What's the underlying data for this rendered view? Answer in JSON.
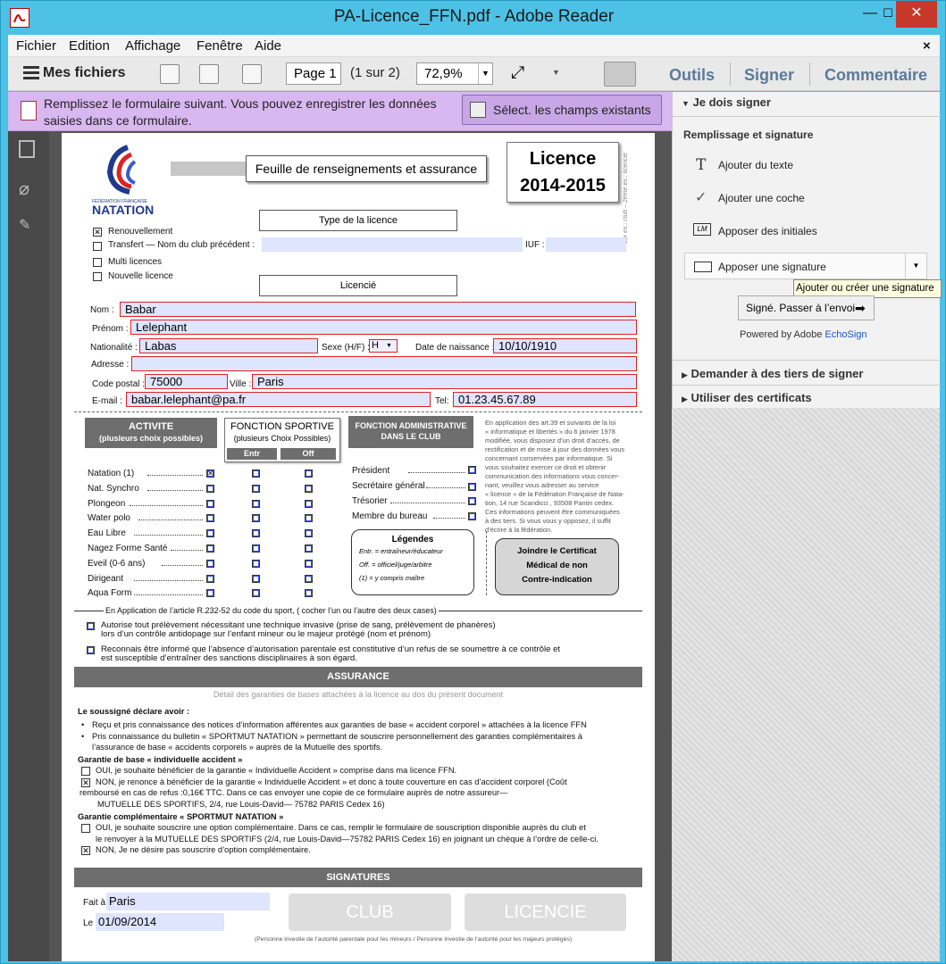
{
  "window": {
    "title": "PA-Licence_FFN.pdf - Adobe Reader",
    "minimize": "—",
    "maximize": "☐",
    "close": "✕"
  },
  "menu": {
    "items": [
      "Fichier",
      "Edition",
      "Affichage",
      "Fenêtre",
      "Aide"
    ],
    "close": "×"
  },
  "toolbar": {
    "my_files": "Mes fichiers",
    "page_value": "Page 1",
    "page_of": "(1 sur 2)",
    "zoom": "72,9%",
    "tabs": [
      "Outils",
      "Signer",
      "Commentaire"
    ]
  },
  "notice": {
    "text": "Remplissez le formulaire suivant. Vous pouvez enregistrer les données saisies dans ce formulaire.",
    "button": "Sélect. les champs existants"
  },
  "panel": {
    "section1": "Je dois signer",
    "subheading": "Remplissage et signature",
    "items": [
      "Ajouter du texte",
      "Ajouter une coche",
      "Apposer des initiales",
      "Apposer une signature"
    ],
    "tooltip": "Ajouter ou créer une signature",
    "send_button": "Signé. Passer à l’envoi",
    "powered": "Powered by Adobe",
    "powered_link": "EchoSign",
    "section2": "Demander à des tiers de signer",
    "section3": "Utiliser des certificats"
  },
  "form": {
    "header_title": "Feuille de renseignements et assurance",
    "licence_l1": "Licence",
    "licence_l2": "2014-2015",
    "logo_small": "FÉDÉRATION FRANÇAISE",
    "logo_big": "NATATION",
    "vertical_note": "1er ex.: club – 2ème ex.: licencié",
    "type_title": "Type de la licence",
    "type_items": [
      "Renouvellement",
      "Transfert — Nom du club précédent :",
      "Multi licences",
      "Nouvelle licence"
    ],
    "iuf": "IUF :",
    "licencie_title": "Licencié",
    "labels": {
      "nom": "Nom :",
      "prenom": "Prénom :",
      "nationalite": "Nationalité :",
      "sexe": "Sexe (H/F) :",
      "naissance": "Date de naissance :",
      "adresse": "Adresse :",
      "cp": "Code postal :",
      "ville": "Ville :",
      "email": "E-mail :",
      "tel": "Tel:"
    },
    "values": {
      "nom": "Babar",
      "prenom": "Lelephant",
      "nationalite": "Labas",
      "sexe": "H",
      "naissance": "10/10/1910",
      "adresse": "",
      "cp": "75000",
      "ville": "Paris",
      "email": "babar.lelephant@pa.fr",
      "tel": "01.23.45.67.89"
    },
    "activite_title": "ACTIVITE",
    "activite_sub": "(plusieurs choix possibles)",
    "sportive_title": "FONCTION SPORTIVE",
    "sportive_sub": "(plusieurs Choix Possibles)",
    "col_entr": "Entr",
    "col_off": "Off",
    "admin_title": "FONCTION ADMINISTRATIVE",
    "admin_sub": "DANS LE CLUB",
    "activities": [
      "Natation (1)",
      "Nat. Synchro",
      "Plongeon",
      "Water polo",
      "Eau Libre",
      "Nagez Forme Santé",
      "Eveil (0-6 ans)",
      "Dirigeant",
      "Aqua Form"
    ],
    "admin_items": [
      "Président",
      "Secrétaire général",
      "Trésorier",
      "Membre du bureau"
    ],
    "privacy": [
      "En application des art.39 et suivants de la loi",
      "« informatique et libertés » du 6 janvier 1978",
      "modifiée, vous disposez d’un droit d’accès, de",
      "rectification et de mise à jour des données vous",
      "concernant conservées par informatique. Si",
      "vous souhaitez exercer ce droit et obtenir",
      "communication des informations vous concer-",
      "nant, veuillez vous adresser au service",
      "« licence » de la Fédération Française de Nata-",
      "tion, 14 rue Scandicci , 93508 Pantin cedex.",
      "Ces informations peuvent être communiquées",
      "à des tiers. Si vous vous y opposez, il suffit",
      "d’écrire à la fédération."
    ],
    "legend_title": "Légendes",
    "legend_items": [
      "Entr. = entraîneur/éducateur",
      "Off.  = officiel/juge/arbitre",
      "(1) = y compris maître"
    ],
    "cert_lines": [
      "Joindre le Certificat",
      "Médical de non",
      "Contre-indication"
    ],
    "art_line": "En Application de l’article R.232-52 du code du sport,  ( cocher l’un ou l’autre des deux cases)",
    "auth1": "Autorise tout prélèvement nécessitant une technique invasive (prise de sang, prélèvement de phanères)",
    "auth1b": "lors d’un contrôle antidopage sur l’enfant mineur ou le majeur protégé (nom et prénom)",
    "auth2": "Reconnais être informé que l’absence d’autorisation parentale est constitutive d’un refus de se soumettre à ce contrôle et",
    "auth2b": "est susceptible d’entraîner des sanctions disciplinaires à son égard.",
    "assurance_title": "ASSURANCE",
    "assurance_sub": "Détail des garanties de bases attachées à la licence au dos du présent document",
    "declare": "Le soussigné déclare avoir :",
    "bullet1": "Reçu et pris connaissance des notices d’information afférentes aux garanties de base « accident corporel » attachées à la licence FFN",
    "bullet2": "Pris connaissance du bulletin « SPORTMUT NATATION » permettant de souscrire personnellement des garanties complémentaires à",
    "bullet2b": "l’assurance de base « accidents corporels » auprès de la Mutuelle des sportifs.",
    "base_title": "Garantie de base « individuelle accident »",
    "base_oui": "OUI, je souhaite bénéficier de la garantie « Individuelle Accident » comprise dans ma licence FFN.",
    "base_non": "NON, je renonce à bénéficier de la garantie « Individuelle Accident » et donc à toute couverture en cas d’accident corporel (Coût",
    "base_non2": "remboursé en cas de refus :0,16€ TTC. Dans ce cas envoyer une copie de ce formulaire auprès de notre assureur—",
    "base_non3": "MUTUELLE DES SPORTIFS, 2/4, rue Louis-David— 75782 PARIS Cedex 16)",
    "comp_title": "Garantie complémentaire « SPORTMUT NATATION »",
    "comp_oui": "OUI, je souhaite souscrire une option complémentaire. Dans ce cas, remplir le formulaire de souscription disponible auprès du club et",
    "comp_oui2": "le renvoyer à la MUTUELLE DES SPORTIFS (2/4, rue Louis-David—75782 PARIS Cedex 16) en joignant un chèque à l’ordre de celle-ci.",
    "comp_non": "NON, Je ne désire pas souscrire d’option complémentaire.",
    "signatures_title": "SIGNATURES",
    "fait": "Fait à",
    "fait_value": "Paris",
    "le": "Le",
    "le_value": "01/09/2014",
    "sig_club": "CLUB",
    "sig_licencie": "LICENCIE",
    "footnote": "(Personne investie de l’autorité parentale pour les mineurs / Personne investie de l’autorité pour les majeurs protégés)"
  },
  "checks": {
    "mark": "✕"
  }
}
